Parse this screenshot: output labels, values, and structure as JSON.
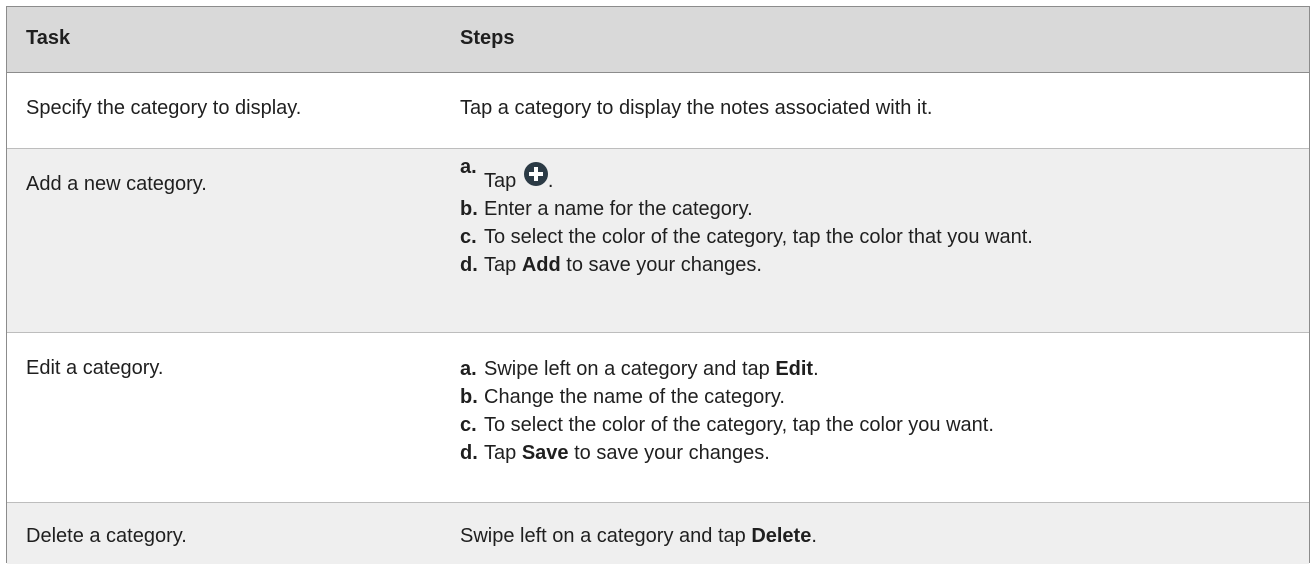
{
  "header": {
    "task": "Task",
    "steps": "Steps"
  },
  "rows": [
    {
      "task": "Specify the category to display.",
      "text": "Tap a category to display the notes associated with it."
    },
    {
      "task": "Add a new category.",
      "steps": [
        {
          "letter": "a.",
          "pre": "Tap",
          "icon": "add-circle-icon",
          "post": "."
        },
        {
          "letter": "b.",
          "pre": "Enter a name for the category."
        },
        {
          "letter": "c.",
          "pre": "To select the color of the category, tap the color that you want."
        },
        {
          "letter": "d.",
          "pre": "Tap ",
          "bold": "Add",
          "post": " to save your changes."
        }
      ]
    },
    {
      "task": "Edit a category.",
      "steps": [
        {
          "letter": "a.",
          "pre": "Swipe left on a category and tap ",
          "bold": "Edit",
          "post": "."
        },
        {
          "letter": "b.",
          "pre": "Change the name of the category."
        },
        {
          "letter": "c.",
          "pre": "To select the color of the category, tap the color you want."
        },
        {
          "letter": "d.",
          "pre": "Tap ",
          "bold": "Save",
          "post": " to save your changes."
        }
      ]
    },
    {
      "task": "Delete a category.",
      "pre": "Swipe left on a category and tap ",
      "bold": "Delete",
      "post": "."
    }
  ],
  "colors": {
    "header_bg": "#d9d9d9",
    "alt_row_bg": "#efefef",
    "icon": "#2b3a45"
  }
}
